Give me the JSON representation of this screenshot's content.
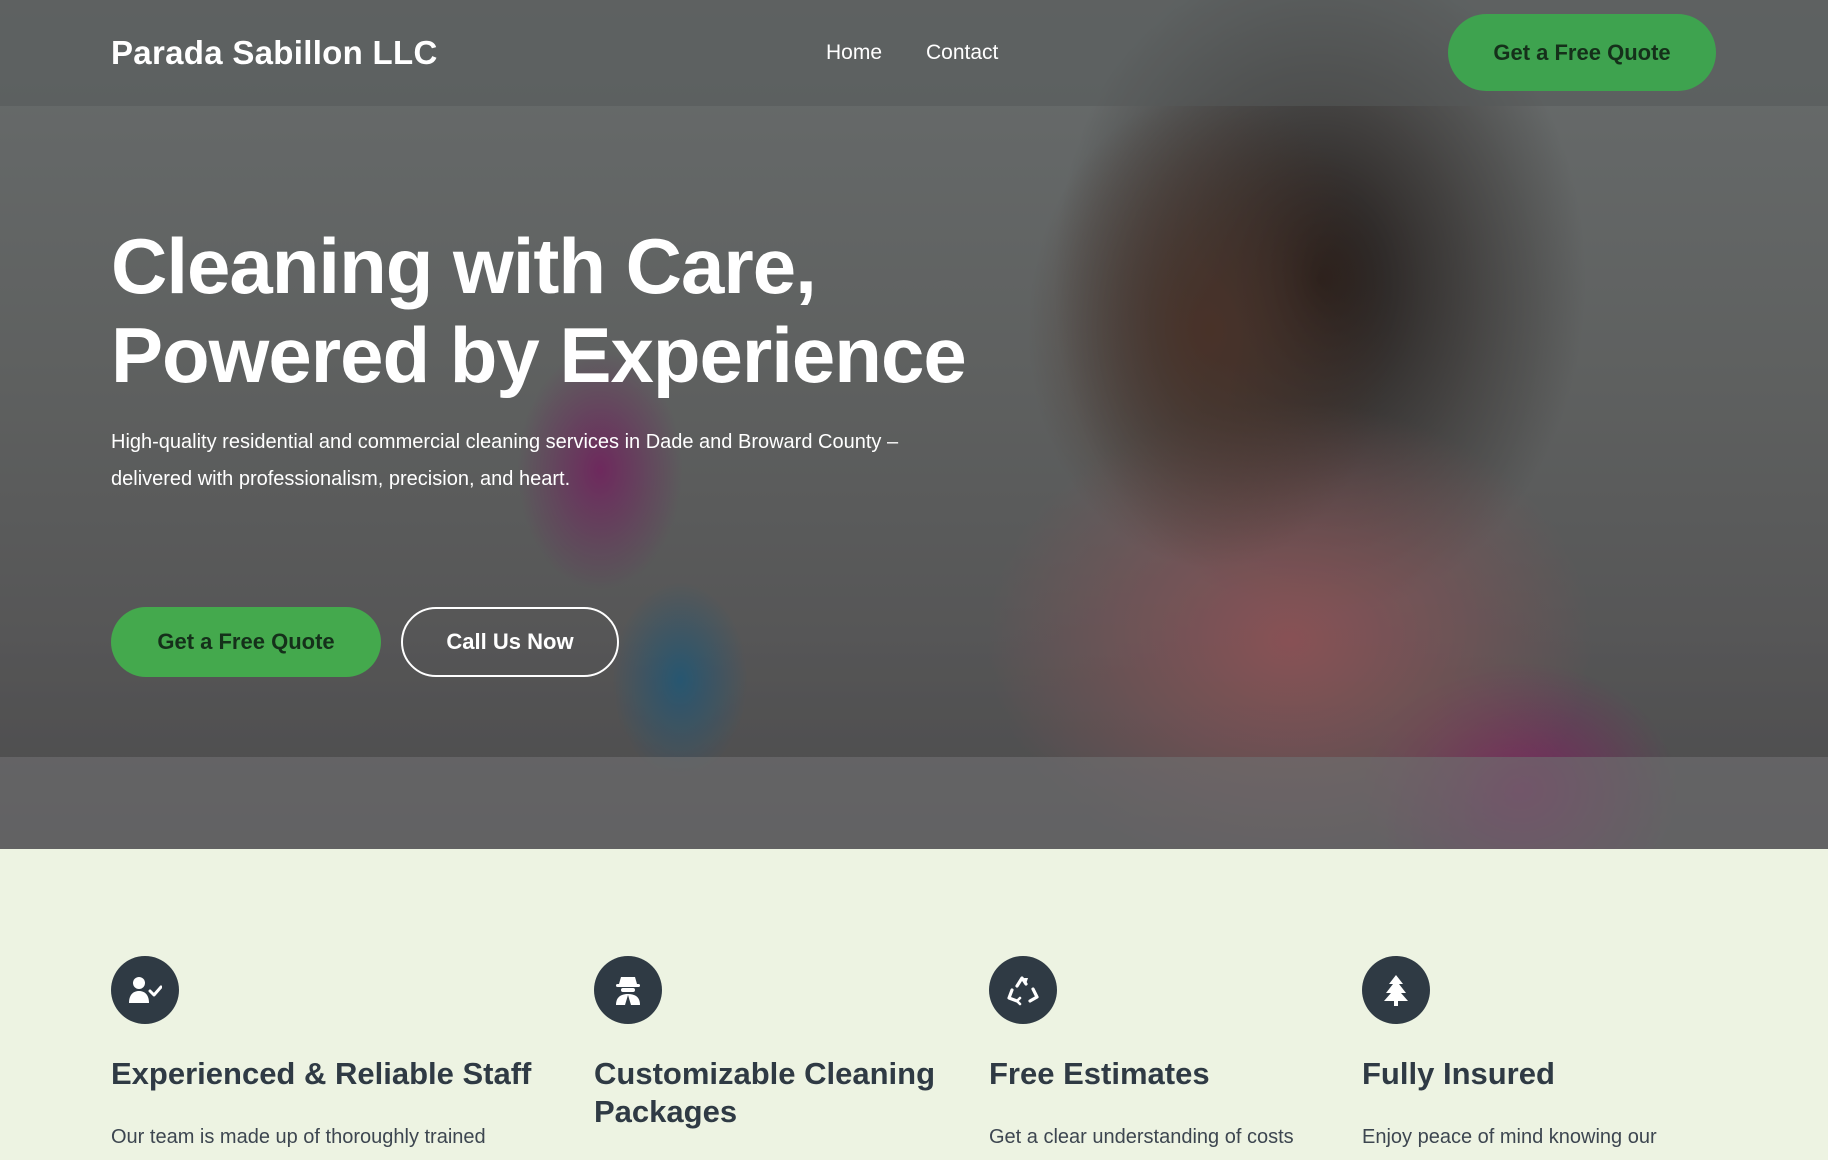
{
  "header": {
    "brand": "Parada Sabillon LLC",
    "nav": [
      {
        "label": "Home"
      },
      {
        "label": "Contact"
      }
    ],
    "cta_label": "Get a Free Quote"
  },
  "hero": {
    "headline_line1": "Cleaning with Care,",
    "headline_line2": "Powered by Experience",
    "subtext": "High-quality residential and commercial cleaning services in Dade and Broward County – delivered with professionalism, precision, and heart.",
    "primary_button": "Get a Free Quote",
    "secondary_button": "Call Us Now"
  },
  "features": [
    {
      "icon": "user-check-icon",
      "title": "Experienced & Reliable Staff",
      "description": "Our team is made up of thoroughly trained"
    },
    {
      "icon": "user-secret-icon",
      "title": "Customizable Cleaning Packages",
      "description": ""
    },
    {
      "icon": "recycle-icon",
      "title": "Free Estimates",
      "description": "Get a clear understanding of costs"
    },
    {
      "icon": "tree-icon",
      "title": "Fully Insured",
      "description": "Enjoy peace of mind knowing our"
    }
  ],
  "colors": {
    "accent_green": "#44a94d",
    "dark_slate": "#2f3a44",
    "features_bg": "#edf3e2"
  }
}
